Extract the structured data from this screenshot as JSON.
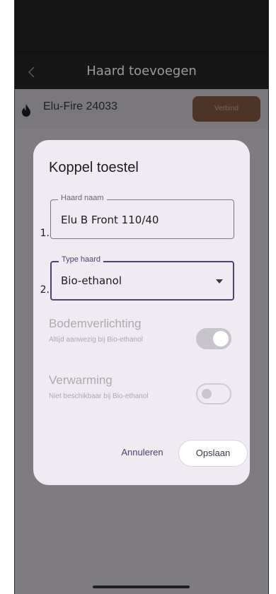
{
  "appbar": {
    "title": "Haard toevoegen",
    "back_icon": "chevron-left-icon"
  },
  "device": {
    "name": "Elu-Fire 24033",
    "icon": "flame-icon",
    "connect_label": "Verbind"
  },
  "dialog": {
    "title": "Koppel toestel",
    "fields": [
      {
        "number": "1.",
        "label": "Haard naam",
        "value": "Elu B Front 110/40"
      },
      {
        "number": "2.",
        "label": "Type haard",
        "value": "Bio-ethanol",
        "icon": "chevron-down-icon"
      }
    ],
    "settings": [
      {
        "title": "Bodemverlichting",
        "subtitle": "Altijd aanwezig bij Bio-ethanol",
        "enabled": true
      },
      {
        "title": "Verwarming",
        "subtitle": "Niet beschikbaar bij Bio-ethanol",
        "enabled": false
      }
    ],
    "cancel_label": "Annuleren",
    "save_label": "Opslaan"
  },
  "colors": {
    "accent": "#4f4170",
    "connect_button": "#4d3425",
    "dialog_bg": "#f0ebf2"
  }
}
